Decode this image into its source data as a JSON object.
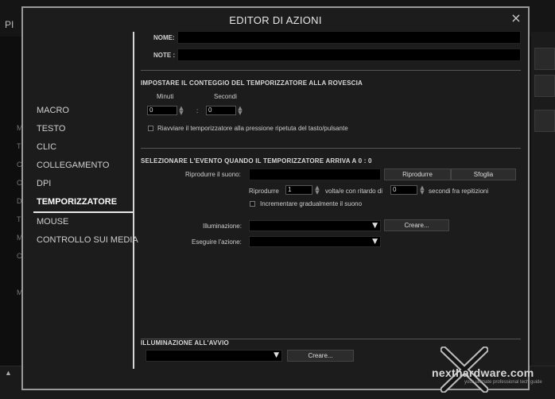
{
  "background": {
    "title": "PI",
    "left_letters": [
      "M",
      "T",
      "C",
      "C",
      "D",
      "T",
      "M",
      "C",
      "M"
    ]
  },
  "modal": {
    "title": "EDITOR DI AZIONI",
    "close_label": "×"
  },
  "sidebar": {
    "items": [
      {
        "label": "MACRO",
        "active": false
      },
      {
        "label": "TESTO",
        "active": false
      },
      {
        "label": "CLIC",
        "active": false
      },
      {
        "label": "COLLEGAMENTO",
        "active": false
      },
      {
        "label": "DPI",
        "active": false
      },
      {
        "label": "TEMPORIZZATORE",
        "active": true
      },
      {
        "label": "MOUSE",
        "active": false
      },
      {
        "label": "CONTROLLO SUI MEDIA",
        "active": false
      }
    ]
  },
  "form": {
    "name_label": "NOME:",
    "note_label": "NOTE :",
    "name_value": "",
    "note_value": ""
  },
  "countdown": {
    "title": "IMPOSTARE IL CONTEGGIO DEL TEMPORIZZATORE ALLA ROVESCIA",
    "minutes_label": "Minuti",
    "seconds_label": "Secondi",
    "minutes_value": "0",
    "seconds_value": "0",
    "separator": ":",
    "restart_label": "Riavviare il temporizzatore alla pressione ripetuta del tasto/pulsante",
    "restart_checked": false
  },
  "event": {
    "title": "SELEZIONARE L'EVENTO QUANDO IL TEMPORIZZATORE ARRIVA A 0 : 0",
    "play_sound_label": "Riprodurre il suono:",
    "play_sound_value": "",
    "play_button": "Riprodurre",
    "browse_button": "Sfoglia",
    "repeat_prefix": "Riprodurre",
    "repeat_value": "1",
    "repeat_mid": "volta/e con ritardo di",
    "delay_value": "0",
    "repeat_suffix": "secondi fra repitizioni",
    "fade_label": "Incrementare gradualmente il suono",
    "fade_checked": false,
    "lighting_label": "Illuminazione:",
    "lighting_value": "",
    "create_button": "Creare...",
    "action_label": "Eseguire l'azione:",
    "action_value": ""
  },
  "startup": {
    "title": "ILLUMINAZIONE ALL'AVVIO",
    "value": "",
    "create_button": "Creare..."
  },
  "watermark": {
    "brand": "nexthardware.com",
    "tagline": "your ultimate professional tech guide"
  },
  "colors": {
    "modal_bg": "#1c1c1c",
    "modal_border": "#9a9a9a",
    "field_bg": "#000000",
    "text": "#cccccc"
  }
}
